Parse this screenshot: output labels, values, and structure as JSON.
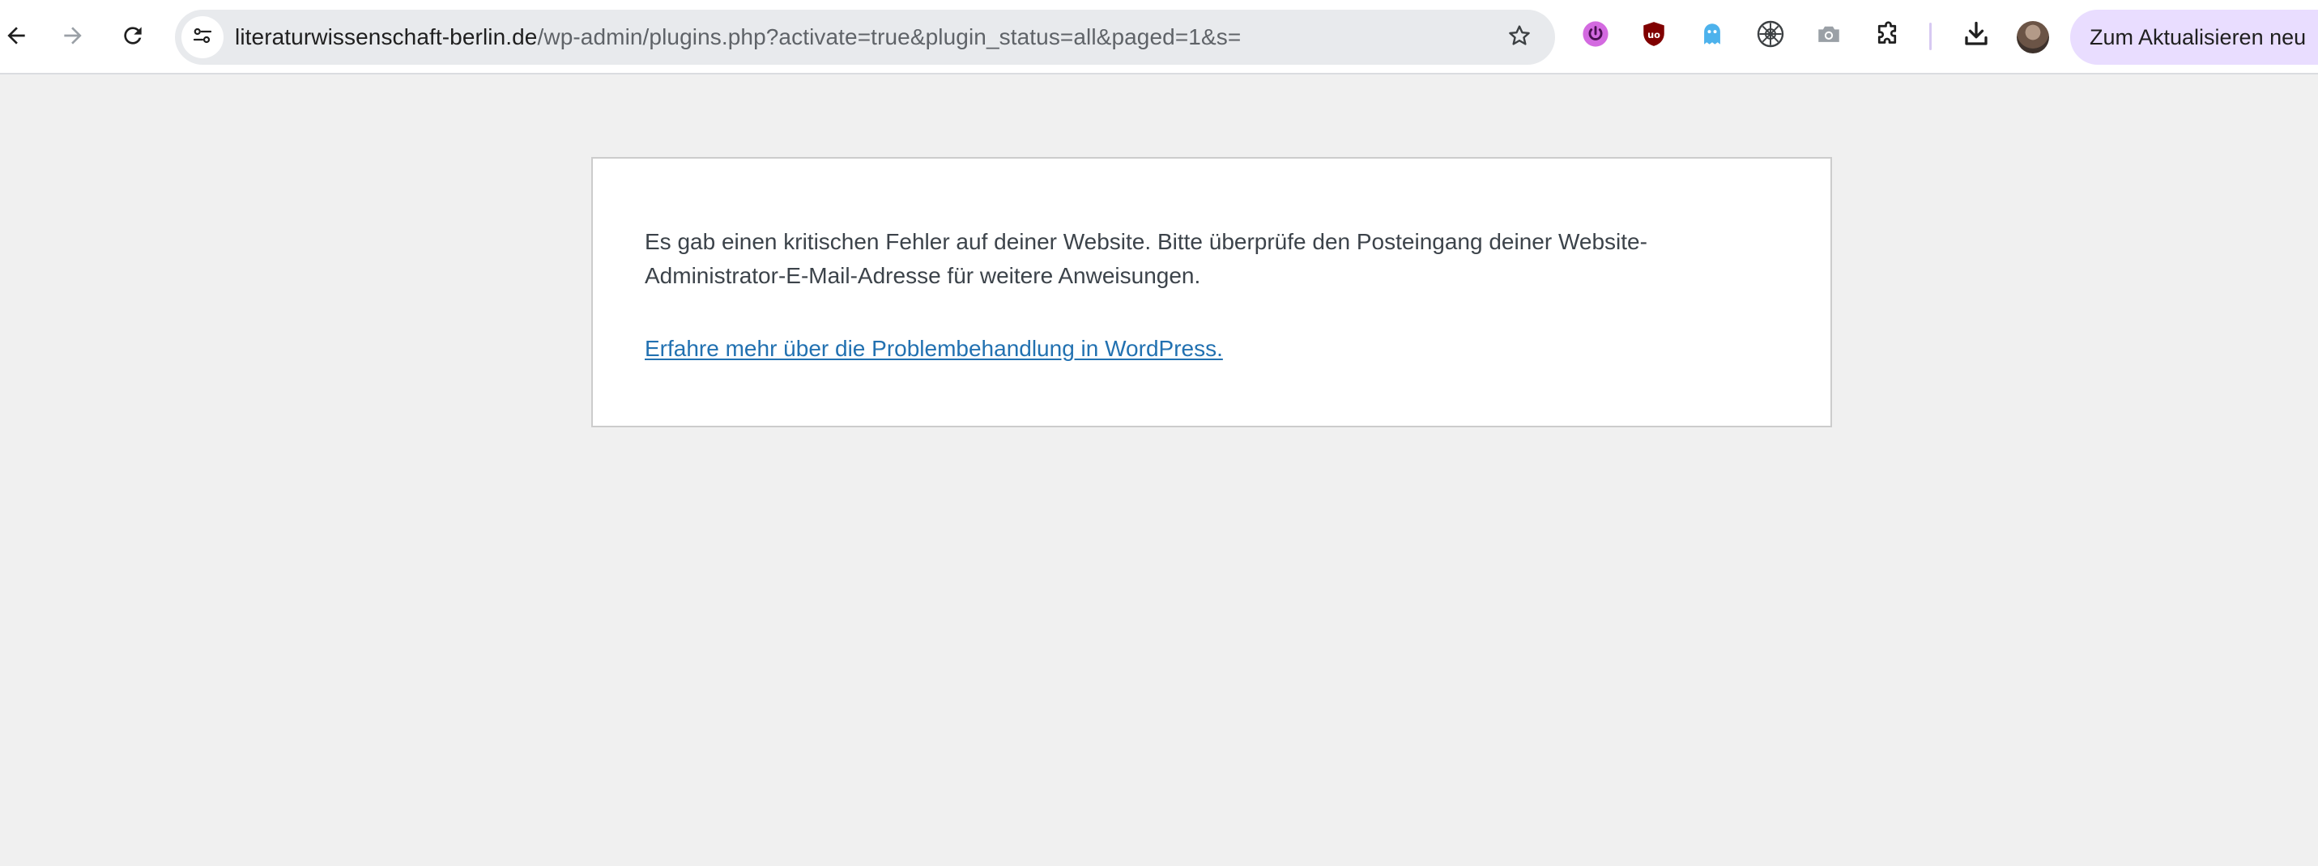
{
  "browser": {
    "url_host": "literaturwissenschaft-berlin.de",
    "url_path": "/wp-admin/plugins.php?activate=true&plugin_status=all&paged=1&s=",
    "update_button_label": "Zum Aktualisieren neu",
    "icons": {
      "back": "arrow-left-icon",
      "forward": "arrow-right-icon",
      "reload": "reload-icon",
      "site_info": "tune-icon",
      "bookmark": "star-icon",
      "extensions": [
        "power-extension-icon",
        "ublock-icon",
        "ghost-extension-icon",
        "perplexity-extension-icon",
        "camera-extension-icon",
        "puzzle-extensions-icon"
      ],
      "download": "download-icon",
      "profile": "avatar"
    },
    "colors": {
      "toolbar_bg": "#ffffff",
      "omnibox_bg": "#e8eaed",
      "update_button_bg": "#e9ddff",
      "ublock_red": "#800000",
      "power_pink": "#d36ae0",
      "ghost_blue": "#4db2ec"
    }
  },
  "error_page": {
    "message": "Es gab einen kritischen Fehler auf deiner Website. Bitte überprüfe den Posteingang deiner Website-Administrator-E-Mail-Adresse für weitere Anweisungen.",
    "link_text": "Erfahre mehr über die Problembehandlung in WordPress.",
    "colors": {
      "page_bg": "#f0f0f0",
      "box_bg": "#ffffff",
      "text": "#3c434a",
      "link": "#2271b1"
    }
  }
}
